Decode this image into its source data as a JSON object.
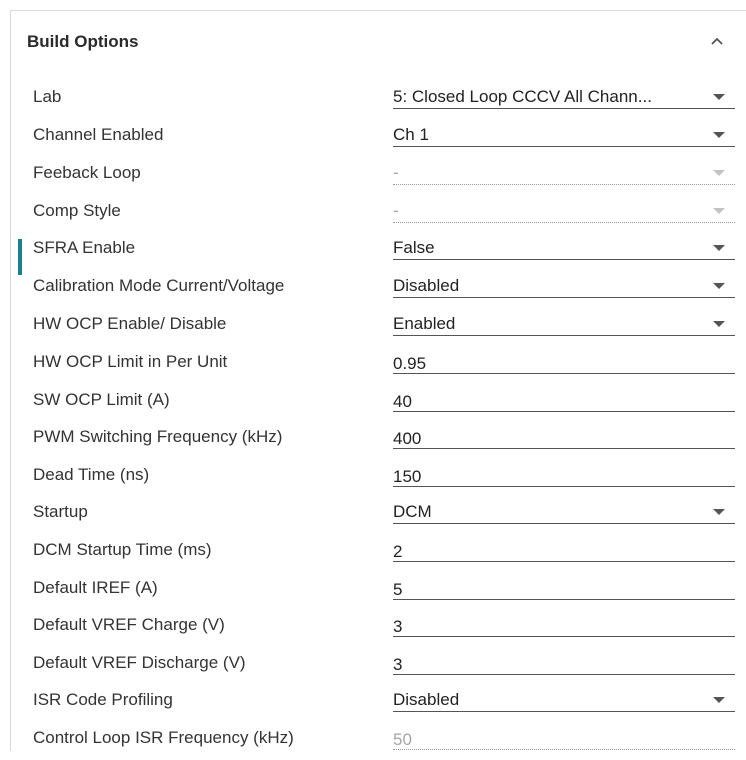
{
  "panel": {
    "title": "Build Options",
    "collapse_icon": "chevron-up-icon"
  },
  "options": [
    {
      "label": "Lab",
      "value": "5: Closed Loop CCCV All Chann...",
      "type": "select",
      "disabled": false
    },
    {
      "label": "Channel Enabled",
      "value": "Ch 1",
      "type": "select",
      "disabled": false
    },
    {
      "label": "Feeback Loop",
      "value": "-",
      "type": "select",
      "disabled": true
    },
    {
      "label": "Comp Style",
      "value": "-",
      "type": "select",
      "disabled": true
    },
    {
      "label": "SFRA Enable",
      "value": "False",
      "type": "select",
      "disabled": false,
      "active": true
    },
    {
      "label": "Calibration Mode Current/Voltage",
      "value": "Disabled",
      "type": "select",
      "disabled": false
    },
    {
      "label": "HW OCP Enable/ Disable",
      "value": "Enabled",
      "type": "select",
      "disabled": false
    },
    {
      "label": "HW OCP Limit in Per Unit",
      "value": "0.95",
      "type": "input",
      "disabled": false
    },
    {
      "label": "SW OCP Limit (A)",
      "value": "40",
      "type": "input",
      "disabled": false
    },
    {
      "label": "PWM Switching Frequency (kHz)",
      "value": "400",
      "type": "input",
      "disabled": false
    },
    {
      "label": "Dead Time (ns)",
      "value": "150",
      "type": "input",
      "disabled": false
    },
    {
      "label": "Startup",
      "value": "DCM",
      "type": "select",
      "disabled": false
    },
    {
      "label": "DCM Startup Time (ms)",
      "value": "2",
      "type": "input",
      "disabled": false
    },
    {
      "label": "Default IREF (A)",
      "value": "5",
      "type": "input",
      "disabled": false
    },
    {
      "label": "Default VREF Charge (V)",
      "value": "3",
      "type": "input",
      "disabled": false
    },
    {
      "label": "Default VREF Discharge (V)",
      "value": "3",
      "type": "input",
      "disabled": false
    },
    {
      "label": "ISR Code Profiling",
      "value": "Disabled",
      "type": "select",
      "disabled": false
    },
    {
      "label": "Control Loop ISR Frequency (kHz)",
      "value": "50",
      "type": "input",
      "disabled": true
    }
  ],
  "colors": {
    "accent": "#1b7e8c",
    "border": "#d9d9d9"
  }
}
